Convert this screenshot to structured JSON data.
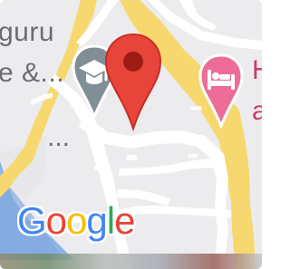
{
  "map": {
    "labels": {
      "poi_top": "guru",
      "poi_bottom": "e &...",
      "poi_partial": "...",
      "hotel_top": "H",
      "hotel_bottom": "a"
    },
    "logo": {
      "letters": [
        "G",
        "o",
        "o",
        "g",
        "l",
        "e"
      ],
      "colors": [
        "#4285f4",
        "#ea4335",
        "#fbbc05",
        "#4285f4",
        "#34a853",
        "#ea4335"
      ]
    },
    "markers": {
      "location_pin": "map-pin-icon",
      "school_marker": "school-icon",
      "hotel_marker": "hotel-icon"
    },
    "colors": {
      "background": "#ececee",
      "road_major": "#f6d86f",
      "road_minor": "#ffffff",
      "water": "#8fb4e6",
      "pin_red": "#e7453a",
      "pin_dark": "#9e1b16",
      "school_gray": "#7f8f95",
      "hotel_pink": "#ee6d97"
    }
  }
}
